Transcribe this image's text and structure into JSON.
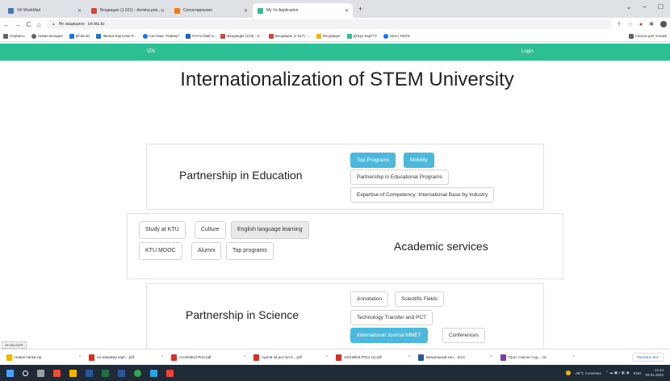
{
  "browser": {
    "tabs": [
      {
        "label": "VK WorkMail",
        "active": false,
        "color": "#4a76a8"
      },
      {
        "label": "Входящие (1 621) - demina.pmi...",
        "active": false,
        "color": "#d44638"
      },
      {
        "label": "Сопоставление",
        "active": false,
        "color": "#e67e22"
      },
      {
        "label": "My Vs Application",
        "active": true,
        "color": "#2dbf94"
      }
    ],
    "new_tab": "+",
    "address": {
      "security": "Не защищено",
      "url": "izn.ktu.kz"
    },
    "bookmarks": [
      {
        "label": "Сервисы",
        "color": "#5f6368"
      },
      {
        "label": "Новая вкладка",
        "color": "#5f6368"
      },
      {
        "label": "pfl.ktu.kz",
        "color": "#1a73e8"
      },
      {
        "label": "Фильм Карточки Р...",
        "color": "#1a73e8"
      },
      {
        "label": "Система \"Универ\"",
        "color": "#1a73e8"
      },
      {
        "label": "Почта Mail.ru",
        "color": "#1565c0"
      },
      {
        "label": "Входящие (103) - К...",
        "color": "#d44638"
      },
      {
        "label": "Входящие (1 617) -...",
        "color": "#d44638"
      },
      {
        "label": "Входящие",
        "color": "#f4b400"
      },
      {
        "label": "ДПЦХ КарГТУ",
        "color": "#2dbf94"
      },
      {
        "label": "Мон | NOTE",
        "color": "#1a73e8"
      }
    ],
    "bookmarks_right": "Список для чтения",
    "status_url": "izn.ktu.kz/#"
  },
  "site": {
    "brand": "IZN",
    "login": "Login",
    "title": "Internationalization of STEM University"
  },
  "cards": {
    "education": {
      "title": "Partnership in Education",
      "buttons": [
        "Top Programs",
        "Mobility",
        "Partnership in Educational Programs",
        "Expertise of Competency: International Base by Industry"
      ]
    },
    "academic": {
      "title": "Academic services",
      "buttons": [
        "Study at KTU",
        "Culture",
        "English language learning",
        "KTU MOOC",
        "Alumni",
        "Top programs"
      ]
    },
    "science": {
      "title": "Partnership in Science",
      "buttons": [
        "Annotation",
        "Scientific Fields",
        "Technology Transfer and PCT",
        "International Journal MMET",
        "Conferences"
      ]
    }
  },
  "downloads": {
    "items": [
      {
        "label": "Новая папка.zip",
        "color": "#f4b400"
      },
      {
        "label": "на заправку карт....pdf",
        "color": "#d93025"
      },
      {
        "label": "ccUntitled.FR12.pdf",
        "color": "#d93025"
      },
      {
        "label": "Адлов на доступ в....pdf",
        "color": "#d93025"
      },
      {
        "label": "12Untitled.FR12 (1).pdf",
        "color": "#d93025"
      },
      {
        "label": "Визуальный кон....docx",
        "color": "#2b579a"
      },
      {
        "label": "Прот. список студ....rar",
        "color": "#7b3fa0"
      }
    ],
    "show_all": "Показать все"
  },
  "taskbar": {
    "weather": "-26°C Солнечно",
    "lang": "ENG",
    "time": "14:44",
    "date": "09.01.2022"
  }
}
